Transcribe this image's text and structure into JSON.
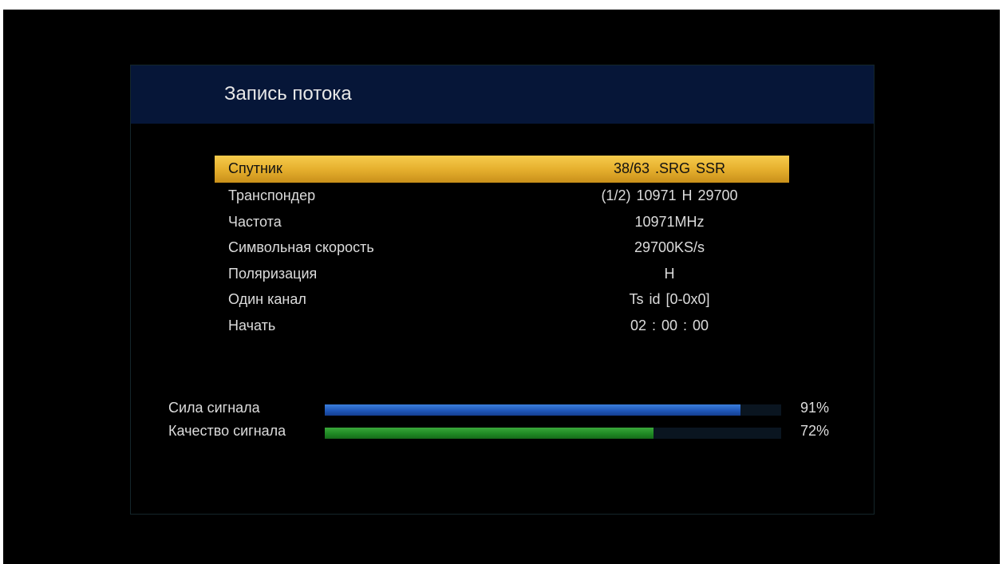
{
  "title": "Запись потока",
  "menu": {
    "items": [
      {
        "label": "Спутник",
        "value": "38/63 .SRG  SSR",
        "selected": true
      },
      {
        "label": "Транспондер",
        "value": "(1/2) 10971 H 29700",
        "selected": false
      },
      {
        "label": "Частота",
        "value": "10971MHz",
        "selected": false
      },
      {
        "label": "Символьная скорость",
        "value": "29700KS/s",
        "selected": false
      },
      {
        "label": "Поляризация",
        "value": "H",
        "selected": false
      },
      {
        "label": "Один канал",
        "value": "Ts id [0-0x0]",
        "selected": false
      },
      {
        "label": "Начать",
        "value": "02 : 00 : 00",
        "selected": false
      }
    ]
  },
  "signal": {
    "strength": {
      "label": "Сила сигнала",
      "percent": 91,
      "percent_text": "91%",
      "color": "#1f57b8"
    },
    "quality": {
      "label": "Качество сигнала",
      "percent": 72,
      "percent_text": "72%",
      "color": "#1f8a24"
    }
  },
  "colors": {
    "header_bg": "#061638",
    "selection": "#e6b02e",
    "background": "#000000"
  }
}
